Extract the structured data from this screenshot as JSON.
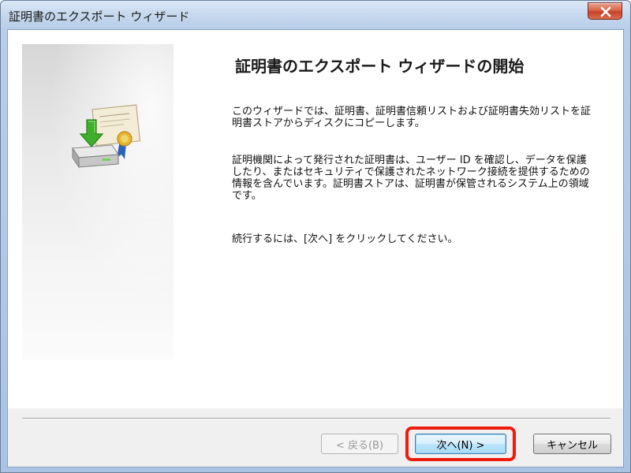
{
  "window": {
    "title": "証明書のエクスポート ウィザード"
  },
  "content": {
    "heading": "証明書のエクスポート ウィザードの開始",
    "paragraph1": "このウィザードでは、証明書、証明書信頼リストおよび証明書失効リストを証明書ストアからディスクにコピーします。",
    "paragraph2": "証明機関によって発行された証明書は、ユーザー ID を確認し、データを保護したり、またはセキュリティで保護されたネットワーク接続を提供するための情報を含んでいます。証明書ストアは、証明書が保管されるシステム上の領域です。",
    "paragraph3": "続行するには、[次へ] をクリックしてください。"
  },
  "buttons": {
    "back": "< 戻る(B)",
    "next": "次へ(N) >",
    "cancel": "キャンセル"
  },
  "icons": {
    "close": "close-icon",
    "wizard": "certificate-export-icon"
  },
  "colors": {
    "highlight": "#ee1c0e",
    "close_button": "#c7432b"
  }
}
